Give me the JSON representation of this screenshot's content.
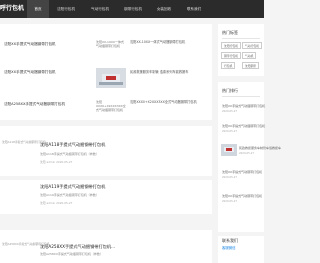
{
  "header": {
    "logo": "呼行包机",
    "nav": [
      "首页",
      "沈阳行包机",
      "气动行包机",
      "钢带行包机",
      "女装回收",
      "联系我们"
    ]
  },
  "featured": {
    "items": [
      {
        "title": "沈阳XX手提式气动捆钢带打包机"
      },
      {
        "title": "沈阳XX手提式气动捆钢带打包机"
      },
      {
        "title": "沈阳A258XX手提式气动捆钢带打包机"
      }
    ],
    "right_items": [
      {
        "alt": "沈阳XX-10XX一体式气动捆钢带打包机"
      },
      {
        "title": "民政救援服务车制管 浩泰系列车载..."
      },
      {
        "alt": "沈阳XXX0+X2XXX3XX全式气动捆钢带打包机"
      }
    ],
    "right_small": [
      "沈阳XX-10XX一体式气动捆钢带打包机",
      "民政救援服务车制管 浩泰系列车载救援车",
      "沈阳XXX0+X2XXX3XX全式气动捆钢带打包机"
    ]
  },
  "posts": [
    {
      "side_label": "沈阳A118手提式气动捆钢带打包机",
      "title": "沈阳A118手提式气动捆钢带打包机",
      "sub": "沈阳A118手提式气动捆钢带打包机（参数）",
      "meta": "沈阳 admin  2020-05-27"
    },
    {
      "side_label": "",
      "title": "沈阳A119手提式气动捆钢带打包机",
      "sub": "沈阳A119手提式气动捆钢带打包机（参数）",
      "meta": "沈阳 admin  2020-05-27"
    },
    {
      "side_label": "沈阳A258XX手提式气动捆钢带打包机",
      "title": "沈阳A258XX手提式气动捆钢带打包机...",
      "sub": "沈阳A258XX手提式气动捆钢带打包机（参数）",
      "meta": "沈阳 admin  2020-05-27"
    }
  ],
  "sidebar": {
    "tags_title": "热门标签",
    "tags": [
      "沈阳行包机",
      "气动行包机",
      "钢带行包机",
      "气动机",
      "行包机",
      "沈阳钢带"
    ],
    "hot_title": "热门排行",
    "hot_items": [
      {
        "title": "沈阳XX手提式气动捆钢带打包机",
        "date": "2020-05-27"
      },
      {
        "title": "沈阳XX手提式气动捆钢带打包机",
        "date": "2020-05-27"
      },
      {
        "title": "民政救援服务车制管车载救援车",
        "date": "2020-05-27"
      },
      {
        "title": "沈阳XX手提式气动钢带打包机",
        "date": "2020-05-27"
      },
      {
        "title": "沈阳XX手提式气动钢带打包机",
        "date": "2020-05-27"
      }
    ],
    "contact_title": "联系我们",
    "contact_sub": "客服微信"
  }
}
